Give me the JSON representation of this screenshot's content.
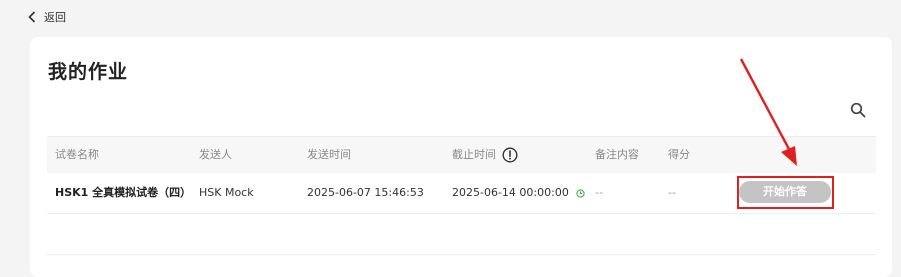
{
  "nav": {
    "back_label": "返回"
  },
  "page": {
    "title": "我的作业"
  },
  "table": {
    "headers": [
      "试卷名称",
      "发送人",
      "发送时间",
      "截止时间",
      "备注内容",
      "得分"
    ],
    "rows": [
      {
        "name": "HSK1 全真模拟试卷（四）",
        "sender": "HSK Mock",
        "sent_time": "2025-06-07 15:46:53",
        "deadline": "2025-06-14 00:00:00",
        "note": "--",
        "score": "--",
        "action_label": "开始作答"
      }
    ]
  },
  "colors": {
    "button_disabled": "#c4c4c4",
    "annotation_red": "#e02020",
    "clock_green": "#3bb54a"
  }
}
